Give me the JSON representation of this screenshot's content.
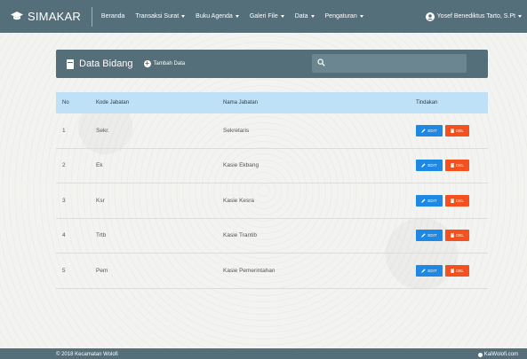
{
  "brand": {
    "name": "SIMAKAR"
  },
  "nav": [
    {
      "label": "Beranda",
      "dropdown": false
    },
    {
      "label": "Transaksi Surat",
      "dropdown": true
    },
    {
      "label": "Buku Agenda",
      "dropdown": true
    },
    {
      "label": "Galeri File",
      "dropdown": true
    },
    {
      "label": "Data",
      "dropdown": true
    },
    {
      "label": "Pengaturan",
      "dropdown": true
    }
  ],
  "user": {
    "name": "Yosef Benediktus Tarto, S.Pt"
  },
  "header": {
    "title": "Data Bidang",
    "add_label": "Tambah Data",
    "search_placeholder": ""
  },
  "table": {
    "columns": [
      "No",
      "Kode Jabatan",
      "Nama Jabatan",
      "Tindakan"
    ],
    "rows": [
      {
        "no": "1",
        "kode": "Sekr.",
        "nama": "Sekretaris"
      },
      {
        "no": "2",
        "kode": "Ek",
        "nama": "Kasie Ekbang"
      },
      {
        "no": "3",
        "kode": "Ksr",
        "nama": "Kasie Kesra"
      },
      {
        "no": "4",
        "kode": "Trtb",
        "nama": "Kasie Trantib"
      },
      {
        "no": "5",
        "kode": "Pem",
        "nama": "Kasie Pemerintahan"
      }
    ],
    "edit_label": "EDIT",
    "del_label": "DEL"
  },
  "footer": {
    "left": "© 2018 Kecamatan Wolofi",
    "right": "KaiWolofi.com"
  },
  "colors": {
    "navbar": "#546e7a",
    "table_header": "#bfe1f7",
    "edit_button": "#1e88e5",
    "delete_button": "#f4511e"
  }
}
